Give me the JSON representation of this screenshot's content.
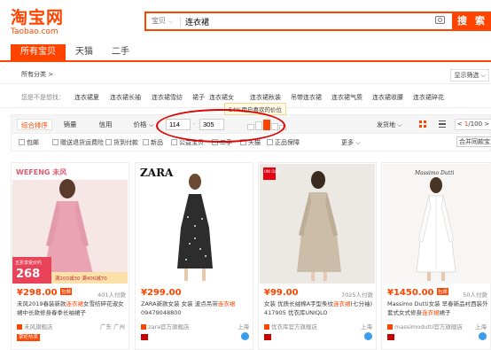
{
  "header": {
    "logo_cn": "淘宝网",
    "logo_en": "Taobao.com",
    "search_category": "宝贝",
    "search_query": "连衣裙",
    "search_button": "搜 索"
  },
  "tabs": [
    "所有宝贝",
    "天猫",
    "二手"
  ],
  "breadcrumb": "所有分类 >",
  "display_filter": "显示筛选 ⌵",
  "related": {
    "title": "您是不是想找：",
    "keywords": [
      "连衣裙夏",
      "连衣裙长袖",
      "连衣裙雪纺",
      "裙子",
      "连衣裙女",
      "连衣裙秋装",
      "吊带连衣裙",
      "连衣裙气质",
      "连衣裙收腰",
      "连衣裙碎花"
    ]
  },
  "sortbar": {
    "items": [
      "综合排序",
      "销量",
      "信用",
      "价格 ⌵"
    ],
    "price_min": "114",
    "price_max": "305",
    "price_tooltip": "54%用户喜欢的价位",
    "price_distribution": [
      0.55,
      0.85,
      1.0,
      0.7,
      0.5
    ],
    "highlighted_bar": 2,
    "ship_from": "发货地 ⌵",
    "page_current": "1",
    "page_total": "/100",
    "page_prev": "<",
    "page_next": ">"
  },
  "filters": {
    "checks": [
      "包邮",
      "赠送退货运费险",
      "货到付款",
      "新品",
      "公益宝贝",
      "二手",
      "天猫",
      "正品保障"
    ],
    "more": "更多 ⌵",
    "merge": "合并同款宝贝"
  },
  "products": [
    {
      "price": "¥298.00",
      "price_tag": "包邮",
      "sold": "401人付款",
      "title_pre": "未风2019春装新款",
      "title_kw": "连衣裙",
      "title_post": "女雪纺碎花淑女裙中长款修身春季长袖裙子",
      "shop": "未风旗舰店",
      "location": "广东 广州",
      "badge": "掌柜热卖",
      "img_brand": "WEFENG 未风",
      "img_promo1": "五折享受价约",
      "img_promo2": "268",
      "img_promo3": "满200减30 满400减70",
      "bg": "#f6e7e6",
      "dress": "#e9a3b2"
    },
    {
      "price": "¥299.00",
      "price_tag": "",
      "sold": "",
      "title_pre": "ZARA新款女装 女装 波点吊带",
      "title_kw": "连衣裙",
      "title_post": " 09479048800",
      "shop": "zara官方旗舰店",
      "location": "上海",
      "badge": "",
      "img_brand": "ZARA",
      "bg": "#ffffff",
      "dress": "#2d2d2d"
    },
    {
      "price": "¥99.00",
      "price_tag": "",
      "sold": "7025人付款",
      "title_pre": "女装 优质长绒棉A字型条纹",
      "title_kw": "连衣裙",
      "title_post": "(七分袖) 417905 优衣库UNIQLO",
      "shop": "优衣库官方旗舰店",
      "location": "上海",
      "badge": "",
      "img_brand": "UNI QLO",
      "bg": "#ece8e3",
      "dress": "#cbbda8"
    },
    {
      "price": "¥1450.00",
      "price_tag": "包邮",
      "sold": "50人付款",
      "title_pre": "Massimo Dutti女装 早春新品衬西装外套式女式修身",
      "title_kw": "连衣裙",
      "title_post": "裙子",
      "shop": "massimodutti官方旗舰店",
      "location": "上海",
      "badge": "",
      "img_brand": "Massimo Dutti",
      "bg": "#f7f6f4",
      "dress": "#ffffff"
    }
  ]
}
